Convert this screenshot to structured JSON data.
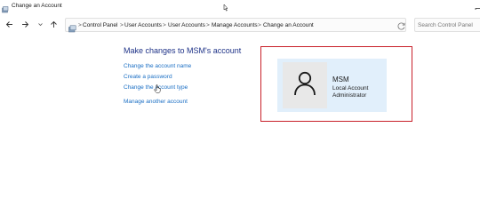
{
  "window": {
    "title": "Change an Account"
  },
  "address_bar": {
    "breadcrumbs": [
      {
        "label": "Control Panel"
      },
      {
        "label": "User Accounts"
      },
      {
        "label": "User Accounts"
      },
      {
        "label": "Manage Accounts"
      },
      {
        "label": "Change an Account"
      }
    ],
    "separator": ">"
  },
  "search": {
    "placeholder": "Search Control Panel"
  },
  "main": {
    "heading": "Make changes to MSM's account",
    "tasks": [
      {
        "label": "Change the account name"
      },
      {
        "label": "Create a password"
      },
      {
        "label": "Change the account type"
      }
    ],
    "manage_link": "Manage another account"
  },
  "account": {
    "name": "MSM",
    "type": "Local Account",
    "role": "Administrator"
  },
  "colors": {
    "heading": "#1e3287",
    "link": "#1a6ec4",
    "highlight_border": "#c8202a",
    "tile_bg": "#e1effb"
  },
  "icons": [
    "control-panel-icon",
    "back-arrow-icon",
    "forward-arrow-icon",
    "chevron-down-icon",
    "up-arrow-icon",
    "refresh-icon",
    "user-avatar-icon",
    "hand-cursor-icon"
  ]
}
